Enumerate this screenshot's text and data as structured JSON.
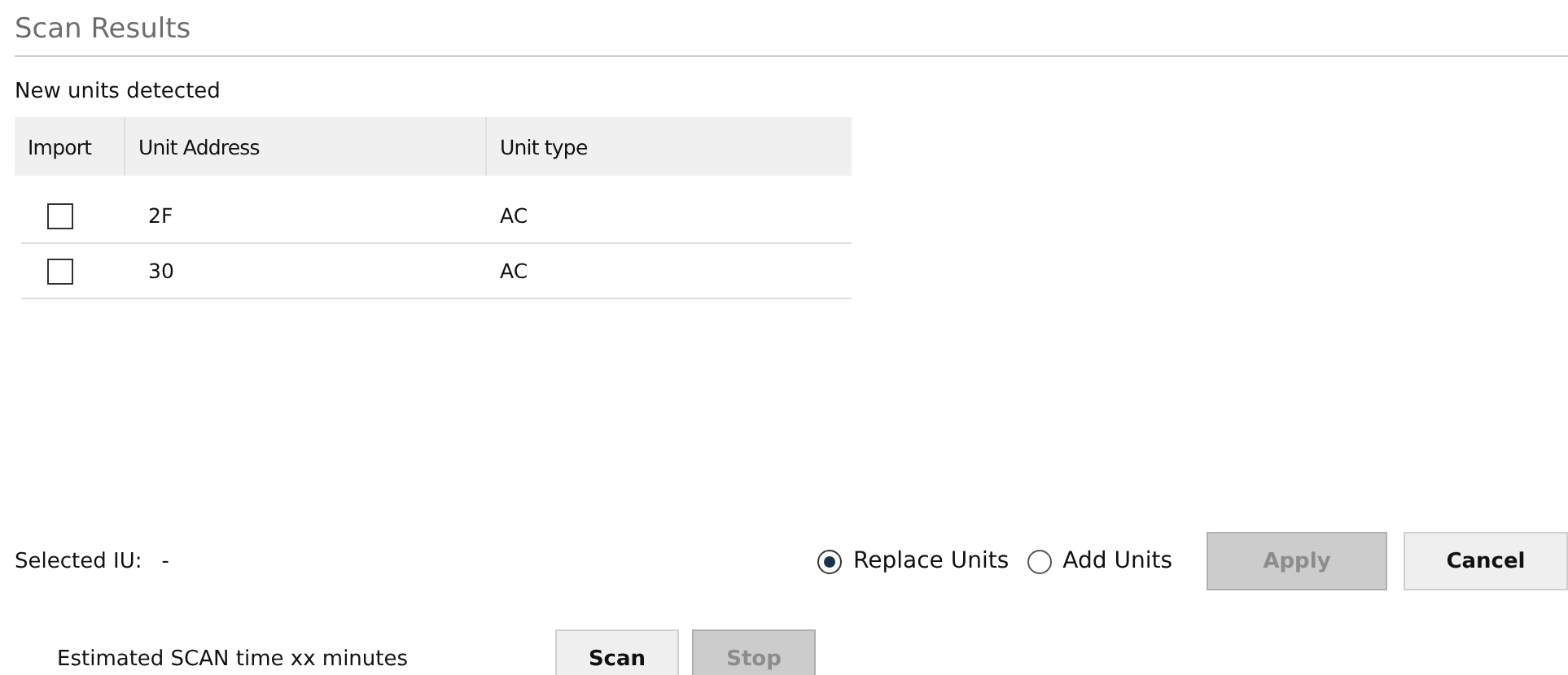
{
  "section_title": "Scan Results",
  "table": {
    "caption": "New units detected",
    "columns": [
      "Import",
      "Unit Address",
      "Unit type"
    ],
    "rows": [
      {
        "checked": false,
        "address": "2F",
        "type": "AC"
      },
      {
        "checked": false,
        "address": "30",
        "type": "AC"
      }
    ]
  },
  "selected_iu": {
    "label": "Selected IU:",
    "value": "-"
  },
  "mode_options": [
    {
      "label": "Replace Units",
      "selected": true
    },
    {
      "label": "Add Units",
      "selected": false
    }
  ],
  "action_buttons": [
    {
      "label": "Apply",
      "disabled": true
    },
    {
      "label": "Cancel",
      "disabled": false
    }
  ],
  "scan_time": "Estimated SCAN time xx minutes",
  "scan_buttons": [
    {
      "label": "Scan",
      "disabled": false
    },
    {
      "label": "Stop",
      "disabled": true
    }
  ]
}
